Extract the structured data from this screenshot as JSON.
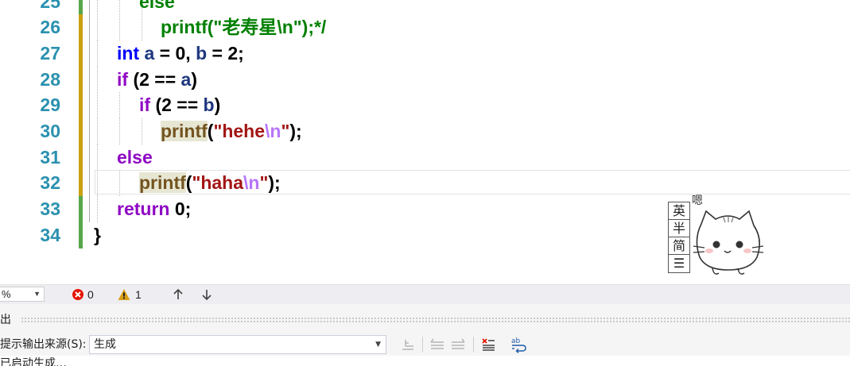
{
  "editor": {
    "lines": [
      {
        "num": "25",
        "tokens": [
          {
            "t": "else",
            "c": "cmt"
          }
        ]
      },
      {
        "num": "26",
        "tokens": [
          {
            "t": "printf(\"老寿星\\n\");*/",
            "c": "cmt"
          }
        ]
      },
      {
        "num": "27",
        "tokens": [
          {
            "t": "int",
            "c": "kw"
          },
          {
            "t": " ",
            "c": ""
          },
          {
            "t": "a",
            "c": "var"
          },
          {
            "t": " = 0, ",
            "c": ""
          },
          {
            "t": "b",
            "c": "var"
          },
          {
            "t": " = 2;",
            "c": ""
          }
        ]
      },
      {
        "num": "28",
        "tokens": [
          {
            "t": "if",
            "c": "ctl"
          },
          {
            "t": " (2 == ",
            "c": ""
          },
          {
            "t": "a",
            "c": "var"
          },
          {
            "t": ")",
            "c": ""
          }
        ]
      },
      {
        "num": "29",
        "tokens": [
          {
            "t": "if",
            "c": "ctl"
          },
          {
            "t": " (2 == ",
            "c": ""
          },
          {
            "t": "b",
            "c": "var"
          },
          {
            "t": ")",
            "c": ""
          }
        ]
      },
      {
        "num": "30",
        "tokens": [
          {
            "t": "printf",
            "c": "fn"
          },
          {
            "t": "(",
            "c": ""
          },
          {
            "t": "\"hehe",
            "c": "str"
          },
          {
            "t": "\\n",
            "c": "esc"
          },
          {
            "t": "\"",
            "c": "str"
          },
          {
            "t": ");",
            "c": ""
          }
        ]
      },
      {
        "num": "31",
        "tokens": [
          {
            "t": "else",
            "c": "ctl"
          }
        ]
      },
      {
        "num": "32",
        "tokens": [
          {
            "t": "printf",
            "c": "fn"
          },
          {
            "t": "(",
            "c": ""
          },
          {
            "t": "\"haha",
            "c": "str"
          },
          {
            "t": "\\n",
            "c": "esc"
          },
          {
            "t": "\"",
            "c": "str"
          },
          {
            "t": ");",
            "c": ""
          }
        ]
      },
      {
        "num": "33",
        "tokens": [
          {
            "t": "return",
            "c": "ctl"
          },
          {
            "t": " 0;",
            "c": ""
          }
        ]
      },
      {
        "num": "34",
        "tokens": [
          {
            "t": "}",
            "c": ""
          }
        ]
      }
    ],
    "colors": {
      "line_number": "#2b91af",
      "keyword": "#0000ff",
      "control_keyword": "#8f08c4",
      "variable": "#1f377f",
      "string": "#a31515",
      "escape": "#b776fb",
      "comment": "#008000",
      "function": "#74531f",
      "saved_marker": "#57a64a",
      "modified_marker": "#c9a012"
    }
  },
  "ime": {
    "buttons": [
      "英",
      "半",
      "简",
      "☰"
    ],
    "sticker_text": "嗯"
  },
  "statusbar": {
    "zoom": "%",
    "errors": "0",
    "warnings": "1"
  },
  "output": {
    "title": "出",
    "source_label": "提示输出来源(S):",
    "source_value": "生成",
    "text_line": "已启动生成…"
  }
}
